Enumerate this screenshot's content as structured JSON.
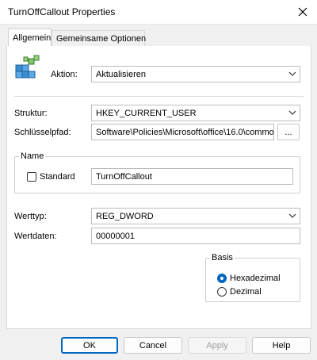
{
  "window": {
    "title": "TurnOffCallout Properties"
  },
  "tabs": [
    {
      "label": "Allgemein"
    },
    {
      "label": "Gemeinsame Optionen"
    }
  ],
  "action": {
    "label": "Aktion:",
    "value": "Aktualisieren"
  },
  "structure": {
    "label": "Struktur:",
    "value": "HKEY_CURRENT_USER"
  },
  "key_path": {
    "label": "Schlüsselpfad:",
    "value": "Software\\Policies\\Microsoft\\office\\16.0\\commo",
    "browse_label": "..."
  },
  "name_group": {
    "legend": "Name",
    "standard_label": "Standard",
    "value": "TurnOffCallout"
  },
  "value_type": {
    "label": "Werttyp:",
    "value": "REG_DWORD"
  },
  "value_data": {
    "label": "Wertdaten:",
    "value": "00000001"
  },
  "base_group": {
    "legend": "Basis",
    "options": [
      {
        "label": "Hexadezimal",
        "checked": true
      },
      {
        "label": "Dezimal",
        "checked": false
      }
    ]
  },
  "buttons": {
    "ok": "OK",
    "cancel": "Cancel",
    "apply": "Apply",
    "help": "Help"
  },
  "icons": {
    "close": "close-icon",
    "registry": "registry-icon",
    "chevron": "chevron-down-icon"
  },
  "colors": {
    "accent": "#0067c0",
    "panel": "#ffffff",
    "dialog": "#f0f0f0"
  }
}
